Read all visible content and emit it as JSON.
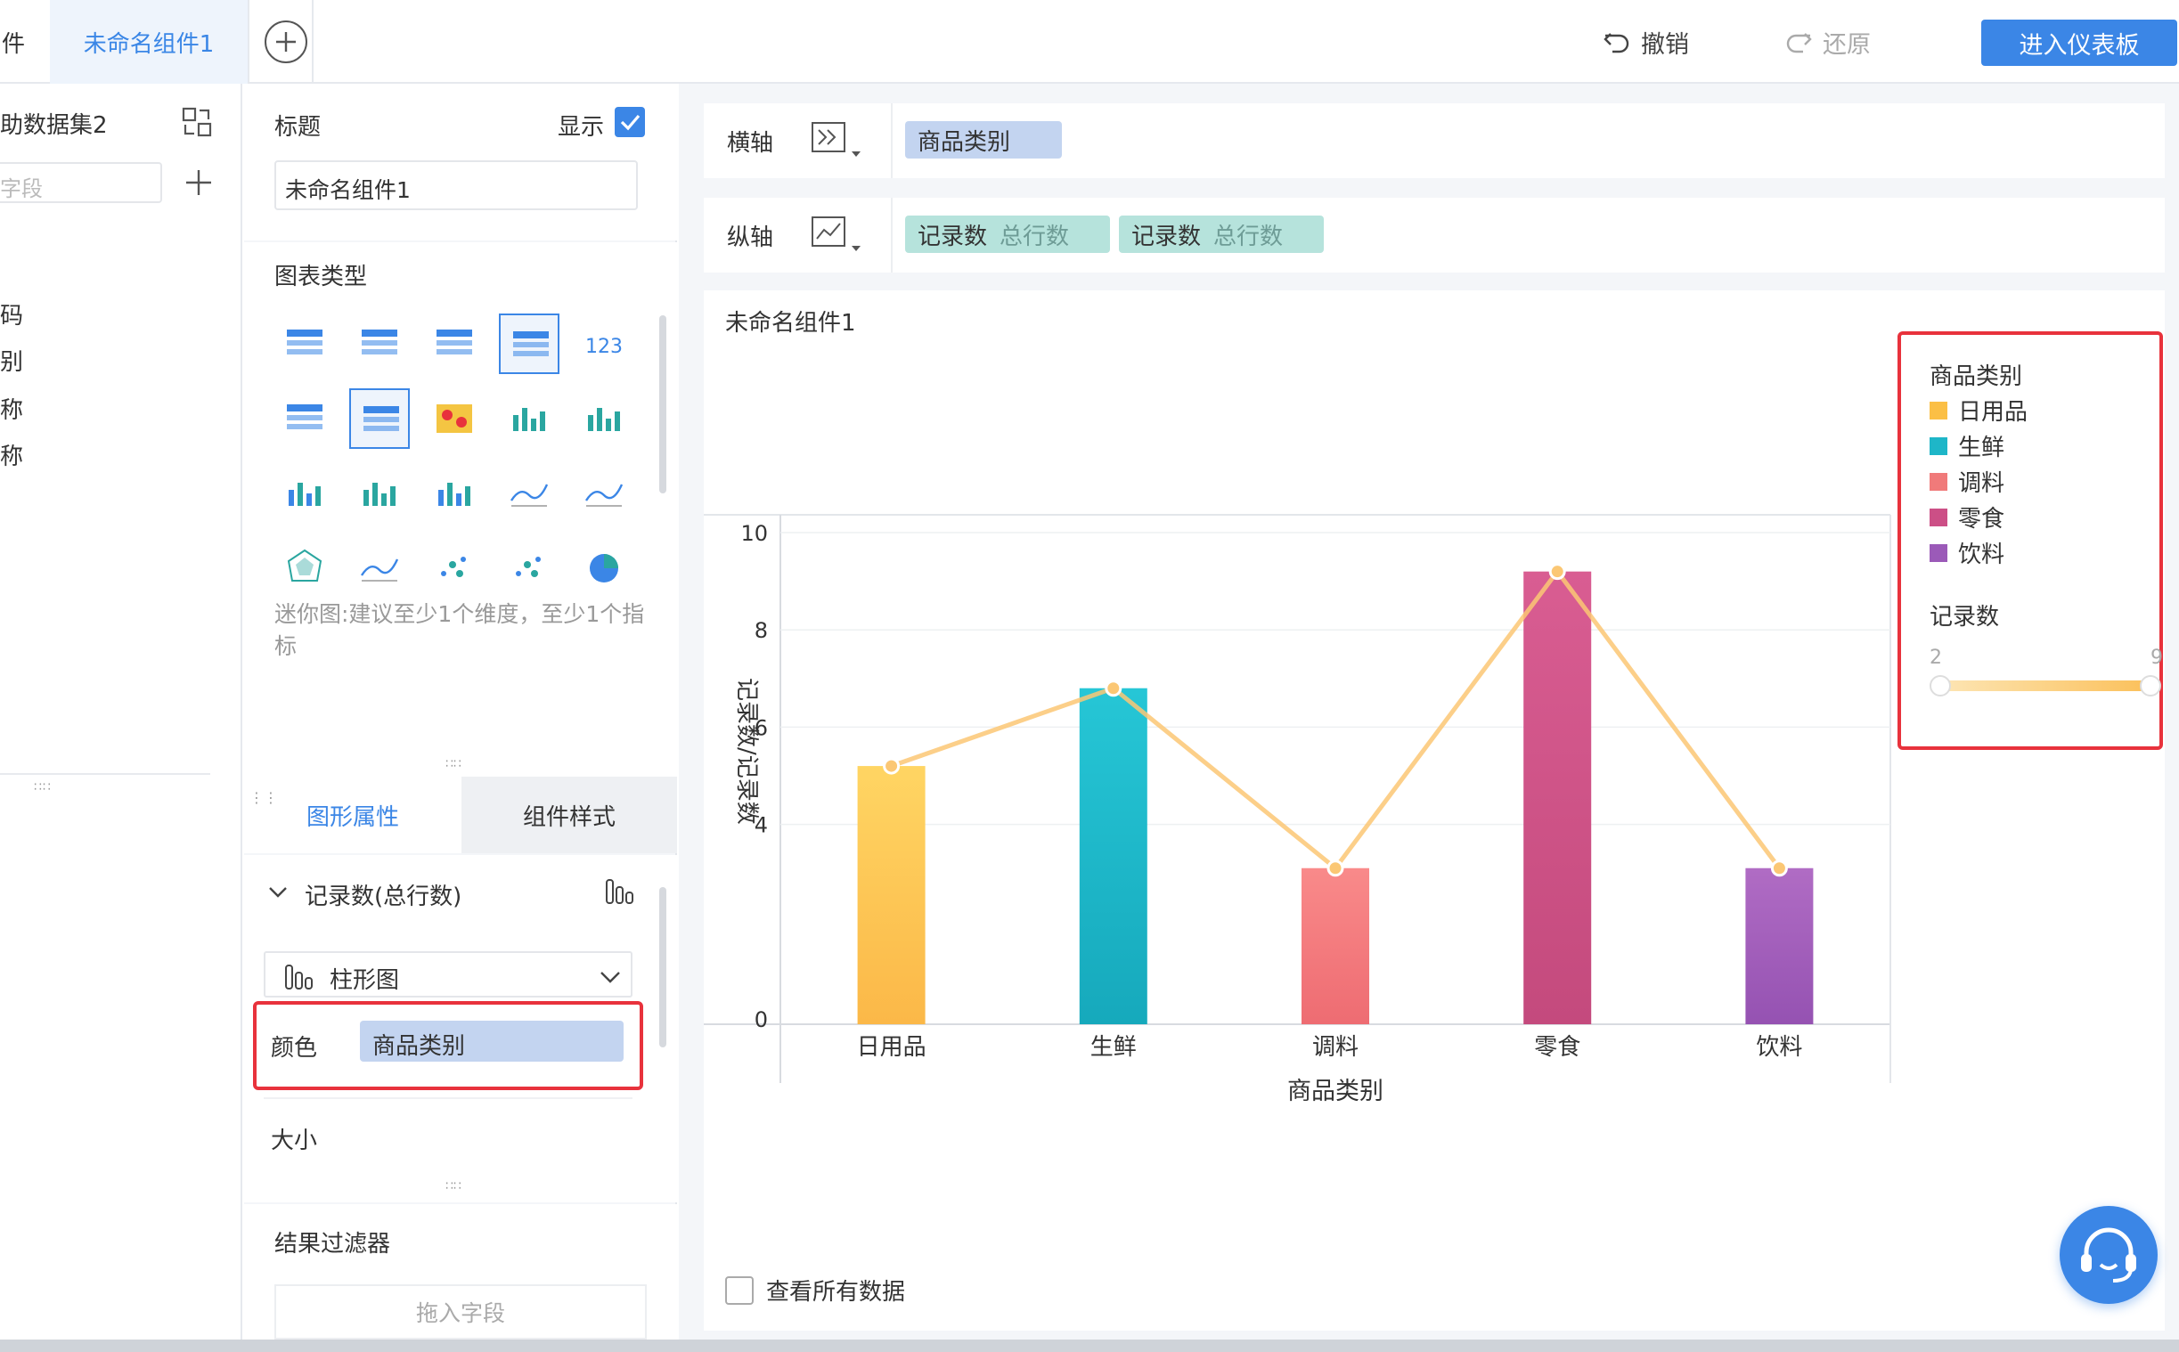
{
  "topbar": {
    "left_tab_fragment": "件",
    "active_tab": "未命名组件1",
    "undo": "撤销",
    "redo": "还原",
    "enter_dashboard": "进入仪表板"
  },
  "left_panel": {
    "dataset_title": "助数据集2",
    "field_search_placeholder": "字段",
    "fields": [
      "码",
      "别",
      "称",
      "称"
    ]
  },
  "mid_panel": {
    "title_label": "标题",
    "show_label": "显示",
    "title_value": "未命名组件1",
    "chart_type_label": "图表类型",
    "hint": "迷你图:建议至少1个维度，至少1个指标",
    "tabs": [
      "图形属性",
      "组件样式"
    ],
    "measure_label": "记录数(总行数)",
    "chart_kind": "柱形图",
    "color_label": "颜色",
    "color_field": "商品类别",
    "size_label": "大小",
    "filter_label": "结果过滤器",
    "filter_drop": "拖入字段"
  },
  "axes": {
    "x_label": "横轴",
    "y_label": "纵轴",
    "x_field": "商品类别",
    "y_fields": [
      {
        "name": "记录数",
        "sub": "总行数"
      },
      {
        "name": "记录数",
        "sub": "总行数"
      }
    ]
  },
  "chart_card": {
    "title": "未命名组件1",
    "view_all": "查看所有数据"
  },
  "legend": {
    "category_title": "商品类别",
    "items": [
      {
        "label": "日用品",
        "color": "#fbbf45"
      },
      {
        "label": "生鲜",
        "color": "#1eb6c8"
      },
      {
        "label": "调料",
        "color": "#f07a7a"
      },
      {
        "label": "零食",
        "color": "#cc4f86"
      },
      {
        "label": "饮料",
        "color": "#9b5ab8"
      }
    ],
    "size_title": "记录数",
    "range_min": "2",
    "range_max": "9"
  },
  "chart_data": {
    "type": "bar",
    "categories": [
      "日用品",
      "生鲜",
      "调料",
      "零食",
      "饮料"
    ],
    "series": [
      {
        "name": "记录数",
        "type": "bar",
        "values": [
          5.2,
          6.8,
          3.1,
          9.2,
          3.1
        ]
      },
      {
        "name": "记录数",
        "type": "line",
        "values": [
          5.2,
          6.8,
          3.1,
          9.2,
          3.1
        ]
      }
    ],
    "bar_colors": [
      [
        "#ffd563",
        "#fbb848"
      ],
      [
        "#26c6d6",
        "#16a9bc"
      ],
      [
        "#f98a8a",
        "#ee6c72"
      ],
      [
        "#d95d92",
        "#c44a7d"
      ],
      [
        "#b06cc4",
        "#9552b2"
      ]
    ],
    "line_color": "#fbc774",
    "xlabel": "商品类别",
    "ylabel": "记录数/记录数",
    "ylim": [
      0,
      10
    ],
    "yticks": [
      "0",
      "4",
      "6",
      "8",
      "10"
    ],
    "ytick_values": [
      0,
      4,
      6,
      8,
      10
    ]
  }
}
